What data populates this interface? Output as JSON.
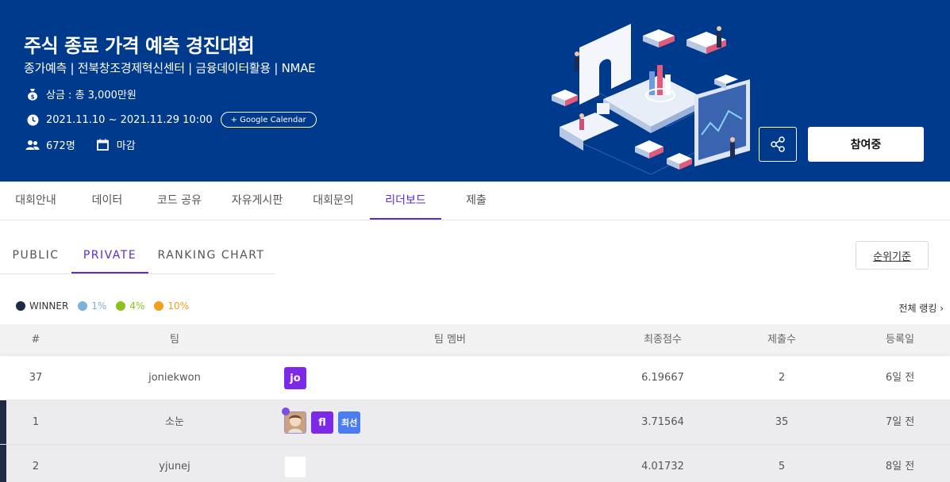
{
  "banner": {
    "title": "주식 종료 가격 예측 경진대회",
    "subtitle": "종가예측 | 전북창조경제혁신센터 | 금융데이터활용 | NMAE",
    "prize": "상금 : 총 3,000만원",
    "period": "2021.11.10 ~ 2021.11.29 10:00",
    "calendar_button": "+ Google Calendar",
    "participants": "672명",
    "status": "마감",
    "join_button": "참여중",
    "background_color": "#003a8c"
  },
  "main_tabs": [
    {
      "label": "대회안내"
    },
    {
      "label": "데이터"
    },
    {
      "label": "코드 공유"
    },
    {
      "label": "자유게시판"
    },
    {
      "label": "대회문의"
    },
    {
      "label": "리더보드",
      "active": true
    },
    {
      "label": "제출"
    }
  ],
  "sub_tabs": [
    {
      "label": "PUBLIC"
    },
    {
      "label": "PRIVATE",
      "active": true
    },
    {
      "label": "RANKING CHART"
    }
  ],
  "rank_criteria_button": "순위기준",
  "legend": [
    {
      "label": "WINNER",
      "color": "#1f2a44"
    },
    {
      "label": "1%",
      "color": "#7fb0d6"
    },
    {
      "label": "4%",
      "color": "#8cc21e"
    },
    {
      "label": "10%",
      "color": "#f0a01e"
    }
  ],
  "full_ranking_link": "전체 랭킹 ›",
  "table": {
    "headers": {
      "rank": "#",
      "team": "팀",
      "members": "팀 멤버",
      "score": "최종점수",
      "submissions": "제출수",
      "date": "등록일"
    },
    "my_row": {
      "rank": "37",
      "team": "joniekwon",
      "members": [
        {
          "type": "badge",
          "text": "jo",
          "color": "#7d2ae8"
        }
      ],
      "score": "6.19667",
      "submissions": "2",
      "date": "6일 전"
    },
    "rows": [
      {
        "rank": "1",
        "team": "소눈",
        "members": [
          {
            "type": "avatar"
          },
          {
            "type": "badge",
            "text": "fl",
            "color": "#7d2ae8"
          },
          {
            "type": "badge",
            "text": "최선",
            "color": "#4a7df0"
          }
        ],
        "score": "3.71564",
        "submissions": "35",
        "date": "7일 전"
      },
      {
        "rank": "2",
        "team": "yjunej",
        "members": [
          {
            "type": "blank"
          }
        ],
        "score": "4.01732",
        "submissions": "5",
        "date": "8일 전"
      }
    ]
  }
}
